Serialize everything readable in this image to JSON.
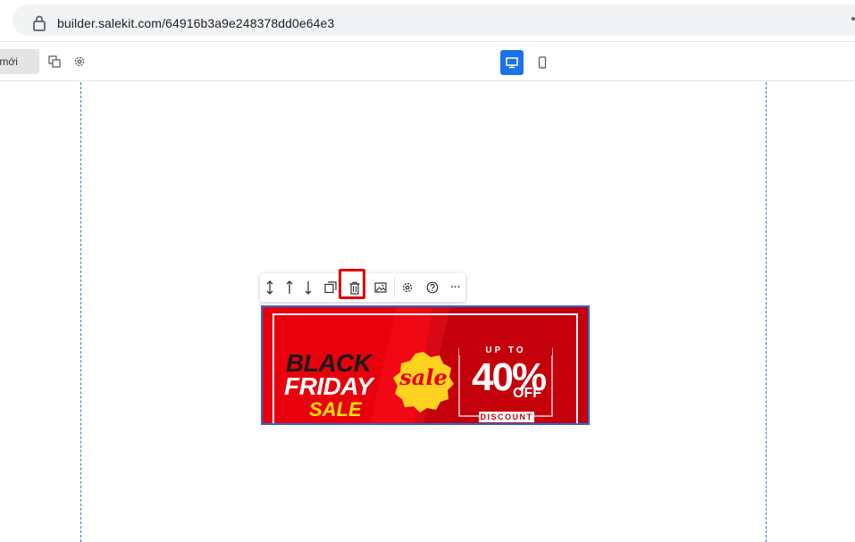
{
  "browser": {
    "url": "builder.salekit.com/64916b3a9e248378dd0e64e3"
  },
  "toolbar": {
    "new_button_label": "m mới",
    "icons": [
      "duplicate-icon",
      "gear-icon"
    ],
    "devices": {
      "desktop": "monitor-icon",
      "mobile": "phone-icon",
      "active": "desktop"
    },
    "accent_color": "#1a73e8"
  },
  "floating_toolbar": {
    "actions": [
      "resize-vertical-icon",
      "move-up-icon",
      "move-down-icon",
      "copy-icon",
      "trash-icon",
      "image-icon",
      "gear-icon",
      "help-icon",
      "more-icon"
    ],
    "more_label": "···",
    "highlighted": "trash-icon",
    "highlight_color": "#e00000"
  },
  "banner": {
    "line1": "BLACK",
    "line2": "FRIDAY",
    "line3": "SALE",
    "badge": "sale",
    "up_to": "UP TO",
    "percent": "40%",
    "off": "OFF",
    "discount": "DISCOUNT",
    "colors": {
      "red": "#e8000c",
      "dark_red": "#c4000b",
      "yellow": "#ffd21f"
    }
  }
}
